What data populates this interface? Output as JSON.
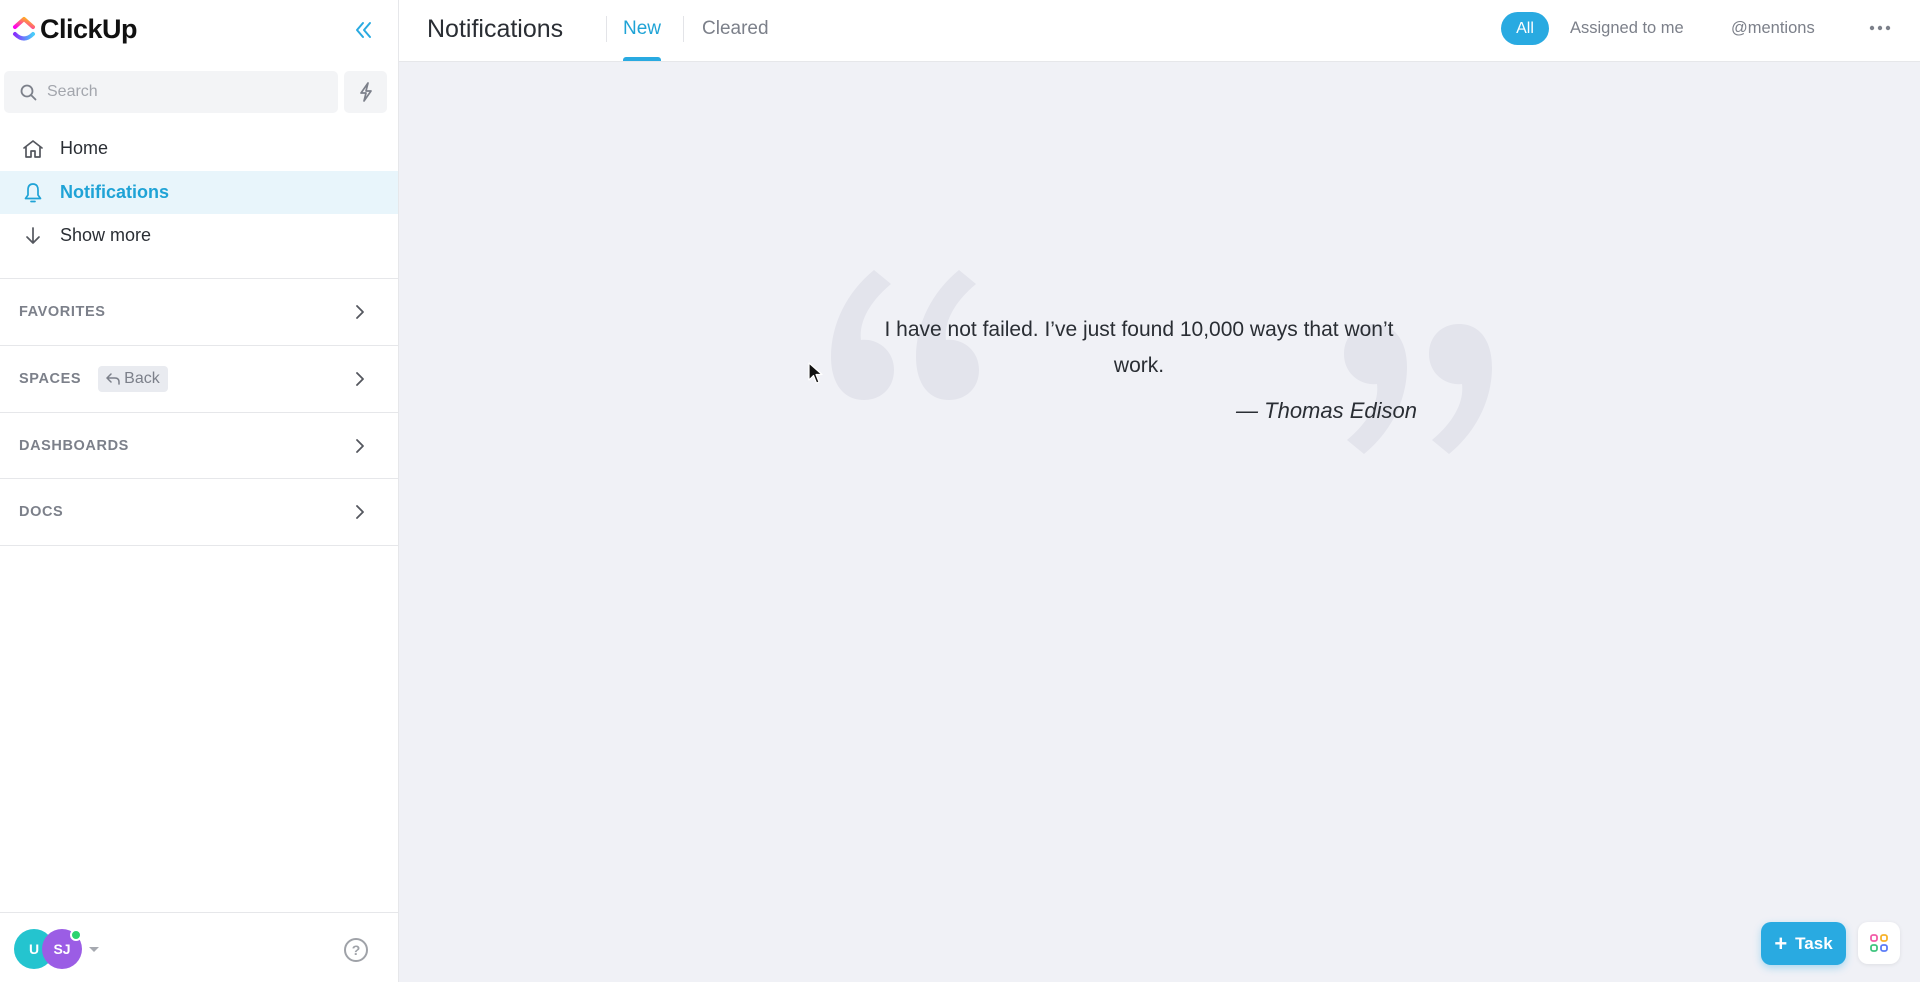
{
  "app": {
    "name": "ClickUp"
  },
  "sidebar": {
    "search": {
      "placeholder": "Search",
      "value": ""
    },
    "nav": [
      {
        "label": "Home",
        "icon": "home-icon"
      },
      {
        "label": "Notifications",
        "icon": "bell-icon",
        "active": true
      },
      {
        "label": "Show more",
        "icon": "arrow-down-icon"
      }
    ],
    "sections": [
      {
        "label": "FAVORITES"
      },
      {
        "label": "SPACES",
        "back_label": "Back"
      },
      {
        "label": "DASHBOARDS"
      },
      {
        "label": "DOCS"
      }
    ],
    "footer": {
      "avatars": [
        {
          "initials": "U",
          "color": "#24c4cf"
        },
        {
          "initials": "SJ",
          "color": "#9b5de5",
          "online": true
        }
      ],
      "help_label": "?"
    }
  },
  "header": {
    "title": "Notifications",
    "tabs": [
      {
        "label": "New",
        "active": true
      },
      {
        "label": "Cleared"
      }
    ],
    "filters": [
      {
        "label": "All",
        "active": true
      },
      {
        "label": "Assigned to me"
      },
      {
        "label": "@mentions"
      }
    ]
  },
  "empty_state": {
    "quote": "I have not failed. I’ve just found 10,000 ways that won’t work.",
    "author": "— Thomas Edison"
  },
  "fab": {
    "task_label": "Task"
  },
  "colors": {
    "accent": "#29aae1",
    "active_text": "#1fa3d6",
    "active_bg": "#e8f5fb",
    "main_bg": "#f0f1f6"
  }
}
